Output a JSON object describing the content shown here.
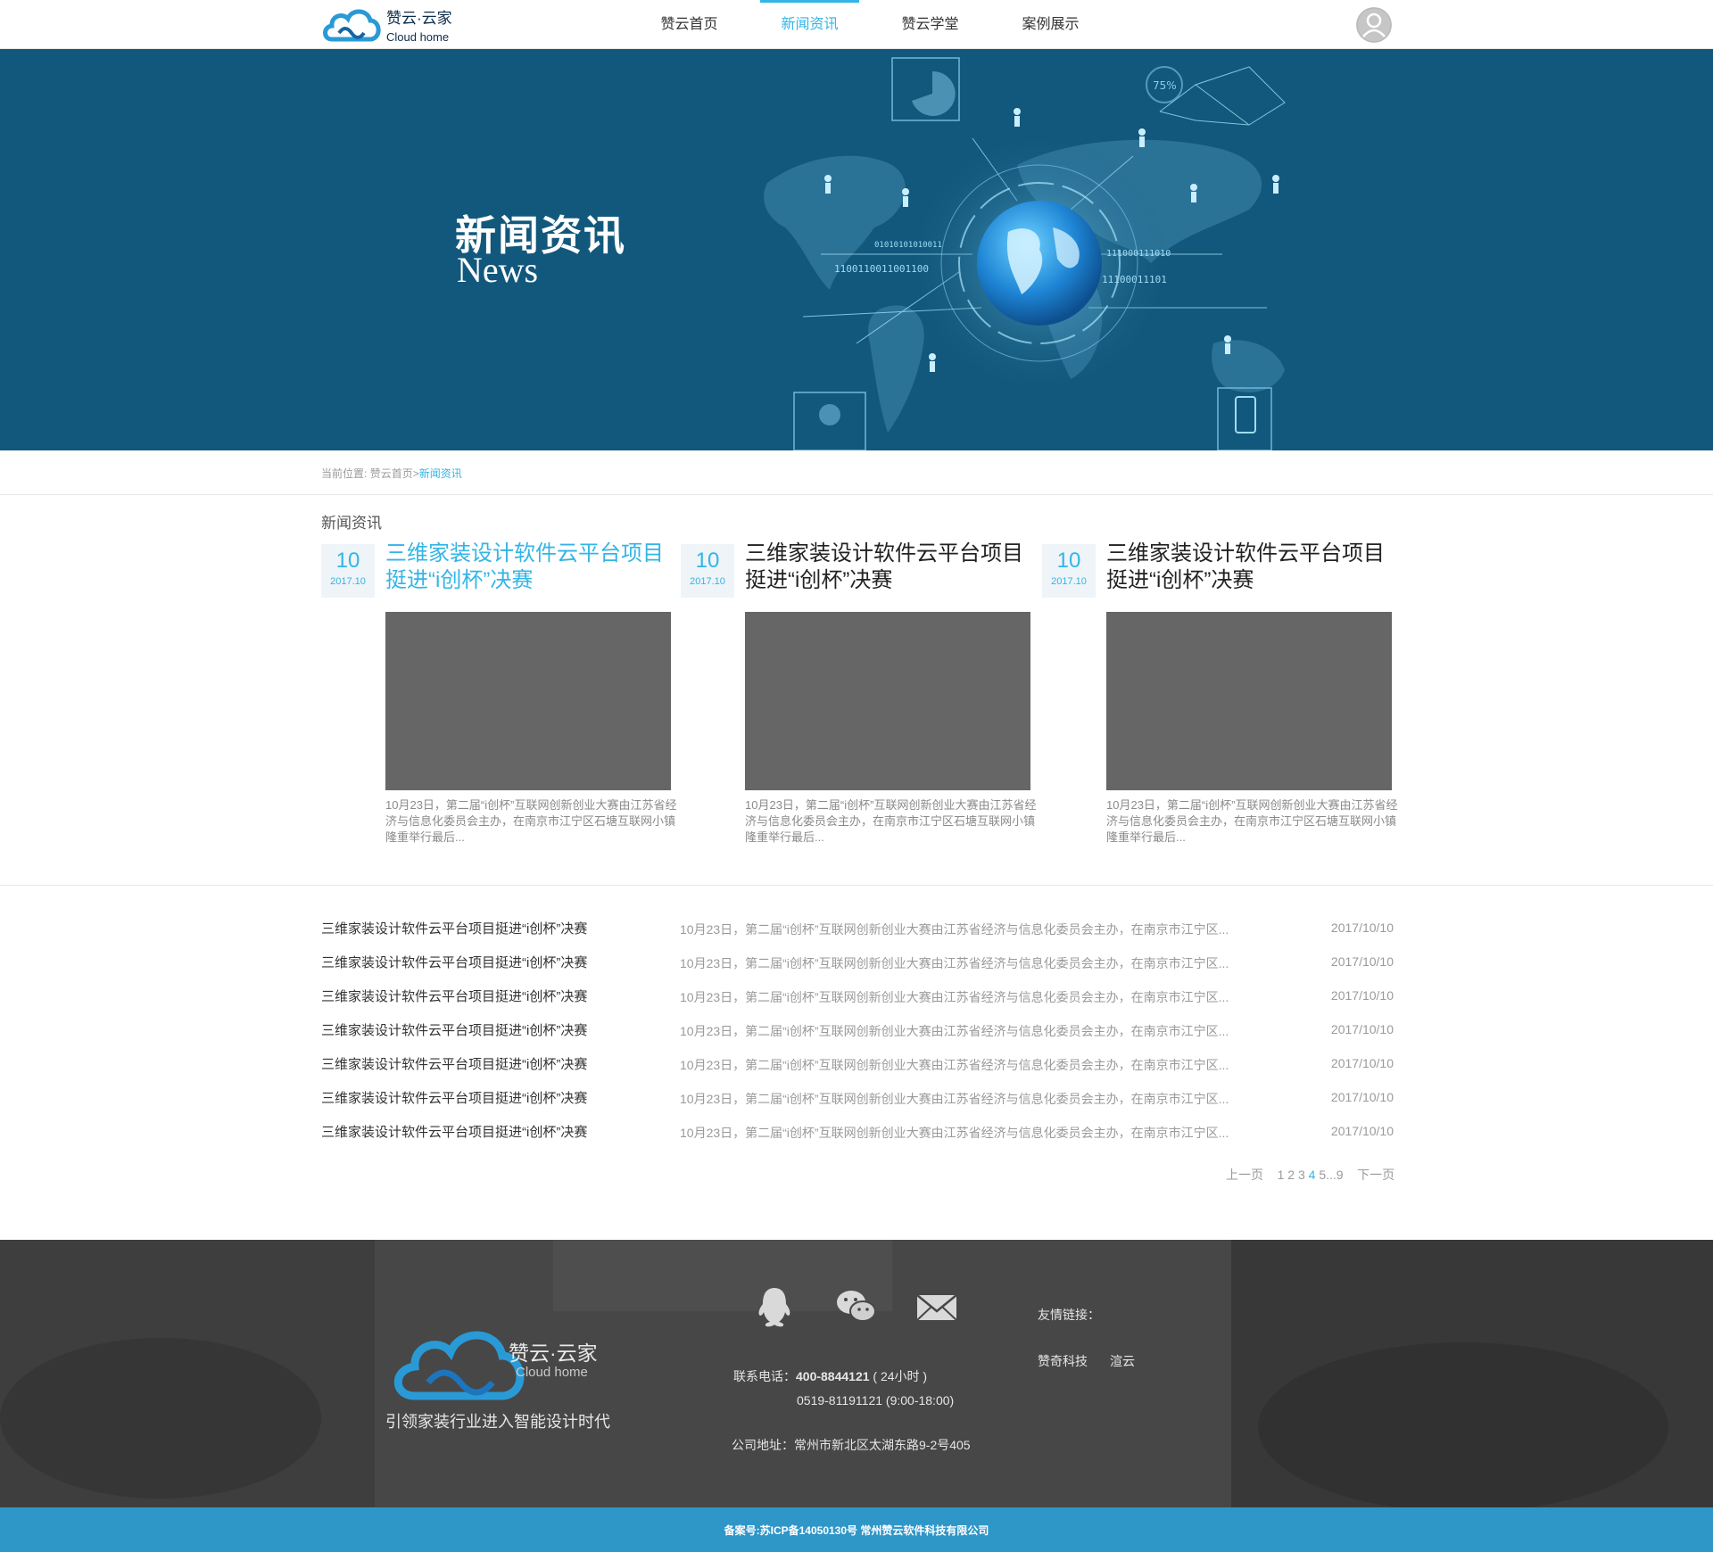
{
  "header": {
    "logo_text": "赞云·云家",
    "logo_sub": "Cloud home",
    "nav": [
      {
        "label": "赞云首页",
        "active": false
      },
      {
        "label": "新闻资讯",
        "active": true
      },
      {
        "label": "赞云学堂",
        "active": false
      },
      {
        "label": "案例展示",
        "active": false
      }
    ],
    "avatar_icon": "user-icon"
  },
  "banner": {
    "title": "新闻资讯",
    "subtitle": "News",
    "background_color": "#12587c",
    "art": {
      "percent_label": "75%",
      "binary_lines": [
        "1100110011001100",
        "01010101010011",
        "111000111010",
        "11100011101"
      ]
    }
  },
  "breadcrumb": {
    "label": "当前位置:",
    "home": "赞云首页",
    "separator": ">",
    "current": "新闻资讯"
  },
  "section_title": "新闻资讯",
  "cards": [
    {
      "day": "10",
      "year_month": "2017.10",
      "title": "三维家装设计软件云平台项目挺进“i创杯”决赛",
      "desc": "10月23日，第二届“i创杯”互联网创新创业大赛由江苏省经济与信息化委员会主办，在南京市江宁区石塘互联网小镇隆重举行最后...",
      "active": true
    },
    {
      "day": "10",
      "year_month": "2017.10",
      "title": "三维家装设计软件云平台项目挺进“i创杯”决赛",
      "desc": "10月23日，第二届“i创杯”互联网创新创业大赛由江苏省经济与信息化委员会主办，在南京市江宁区石塘互联网小镇隆重举行最后...",
      "active": false
    },
    {
      "day": "10",
      "year_month": "2017.10",
      "title": "三维家装设计软件云平台项目挺进“i创杯”决赛",
      "desc": "10月23日，第二届“i创杯”互联网创新创业大赛由江苏省经济与信息化委员会主办，在南京市江宁区石塘互联网小镇隆重举行最后...",
      "active": false
    }
  ],
  "news_list": [
    {
      "title": "三维家装设计软件云平台项目挺进“i创杯”决赛",
      "desc": "10月23日，第二届“i创杯”互联网创新创业大赛由江苏省经济与信息化委员会主办，在南京市江宁区...",
      "date": "2017/10/10"
    },
    {
      "title": "三维家装设计软件云平台项目挺进“i创杯”决赛",
      "desc": "10月23日，第二届“i创杯”互联网创新创业大赛由江苏省经济与信息化委员会主办，在南京市江宁区...",
      "date": "2017/10/10"
    },
    {
      "title": "三维家装设计软件云平台项目挺进“i创杯”决赛",
      "desc": "10月23日，第二届“i创杯”互联网创新创业大赛由江苏省经济与信息化委员会主办，在南京市江宁区...",
      "date": "2017/10/10"
    },
    {
      "title": "三维家装设计软件云平台项目挺进“i创杯”决赛",
      "desc": "10月23日，第二届“i创杯”互联网创新创业大赛由江苏省经济与信息化委员会主办，在南京市江宁区...",
      "date": "2017/10/10"
    },
    {
      "title": "三维家装设计软件云平台项目挺进“i创杯”决赛",
      "desc": "10月23日，第二届“i创杯”互联网创新创业大赛由江苏省经济与信息化委员会主办，在南京市江宁区...",
      "date": "2017/10/10"
    },
    {
      "title": "三维家装设计软件云平台项目挺进“i创杯”决赛",
      "desc": "10月23日，第二届“i创杯”互联网创新创业大赛由江苏省经济与信息化委员会主办，在南京市江宁区...",
      "date": "2017/10/10"
    },
    {
      "title": "三维家装设计软件云平台项目挺进“i创杯”决赛",
      "desc": "10月23日，第二届“i创杯”互联网创新创业大赛由江苏省经济与信息化委员会主办，在南京市江宁区...",
      "date": "2017/10/10"
    }
  ],
  "pager": {
    "prev": "上一页",
    "pages": [
      "1",
      "2",
      "3",
      "4",
      "5",
      "...",
      "9"
    ],
    "current": "4",
    "next": "下一页"
  },
  "footer": {
    "logo_text": "赞云·云家",
    "logo_sub": "Cloud home",
    "slogan": "引领家装行业进入智能设计时代",
    "icons": [
      "qq-icon",
      "wechat-icon",
      "mail-icon"
    ],
    "phone_label": "联系电话：",
    "phone": "400-8844121",
    "phone_note": "( 24小时 )",
    "phone2": "0519-81191121 (9:00-18:00)",
    "address": "公司地址：常州市新北区太湖东路9-2号405",
    "links_label": "友情链接：",
    "links": [
      "赞奇科技",
      "渲云"
    ]
  },
  "bottom_bar": {
    "text": "备案号:苏ICP备14050130号    常州赞云软件科技有限公司",
    "color": "#2f96c8"
  },
  "colors": {
    "accent": "#33b5e5",
    "banner": "#12587c",
    "placeholder_image": "#666666"
  }
}
